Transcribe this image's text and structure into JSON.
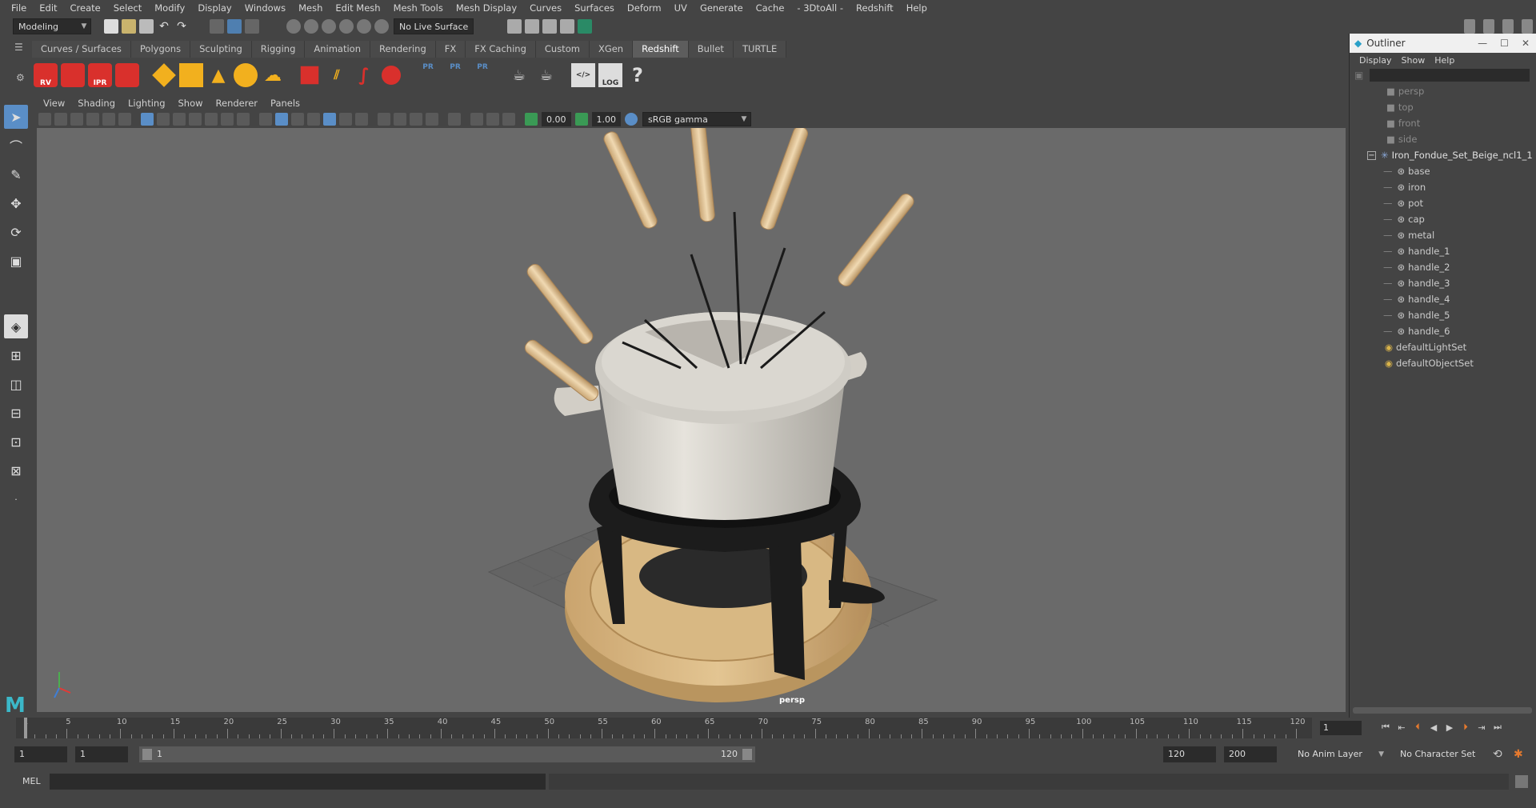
{
  "menubar": {
    "items": [
      "File",
      "Edit",
      "Create",
      "Select",
      "Modify",
      "Display",
      "Windows",
      "Mesh",
      "Edit Mesh",
      "Mesh Tools",
      "Mesh Display",
      "Curves",
      "Surfaces",
      "Deform",
      "UV",
      "Generate",
      "Cache",
      "- 3DtoAll -",
      "Redshift",
      "Help"
    ]
  },
  "statusline": {
    "mode": "Modeling",
    "live_surface": "No Live Surface"
  },
  "shelf": {
    "tabs": [
      "Curves / Surfaces",
      "Polygons",
      "Sculpting",
      "Rigging",
      "Animation",
      "Rendering",
      "FX",
      "FX Caching",
      "Custom",
      "XGen",
      "Redshift",
      "Bullet",
      "TURTLE"
    ],
    "active_tab": "Redshift",
    "icon_labels": [
      "RV",
      "IPR",
      "PR",
      "PR",
      "PR",
      "LOG",
      "?"
    ]
  },
  "panel": {
    "menus": [
      "View",
      "Shading",
      "Lighting",
      "Show",
      "Renderer",
      "Panels"
    ],
    "near_value": "0.00",
    "far_value": "1.00",
    "color_space": "sRGB gamma",
    "camera_label": "persp"
  },
  "outliner": {
    "title": "Outliner",
    "menus": [
      "Display",
      "Show",
      "Help"
    ],
    "cameras": [
      "persp",
      "top",
      "front",
      "side"
    ],
    "group": "Iron_Fondue_Set_Beige_ncl1_1",
    "children": [
      "base",
      "iron",
      "pot",
      "cap",
      "metal",
      "handle_1",
      "handle_2",
      "handle_3",
      "handle_4",
      "handle_5",
      "handle_6"
    ],
    "sets": [
      "defaultLightSet",
      "defaultObjectSet"
    ]
  },
  "timeline": {
    "ticks": [
      "1",
      "5",
      "10",
      "15",
      "20",
      "25",
      "30",
      "35",
      "40",
      "45",
      "50",
      "55",
      "60",
      "65",
      "70",
      "75",
      "80",
      "85",
      "90",
      "95",
      "100",
      "105",
      "110",
      "115",
      "120"
    ],
    "current_frame": "1"
  },
  "range": {
    "start": "1",
    "playback_start": "1",
    "slider_start": "1",
    "slider_end": "120",
    "playback_end": "120",
    "end": "200",
    "anim_layer": "No Anim Layer",
    "character_set": "No Character Set"
  },
  "cmdline": {
    "label": "MEL"
  },
  "colors": {
    "redshift_red": "#d9302c",
    "accent_blue": "#5a8ec7",
    "wood": "#d8b27a",
    "pot": "#d9d6cf"
  }
}
